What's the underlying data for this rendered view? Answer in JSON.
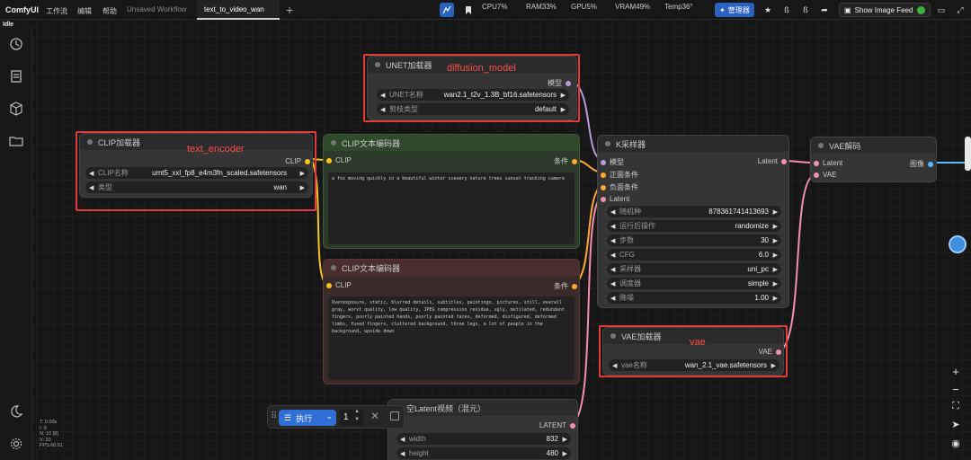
{
  "app": {
    "logo": "ComfyUI"
  },
  "menu": [
    "工作流",
    "编辑",
    "帮助"
  ],
  "tabs": [
    "Unsaved Workflow",
    "text_to_video_wan"
  ],
  "stats": {
    "cpu": "CPU7%",
    "ram": "RAM33%",
    "gpu": "GPU5%",
    "vram": "VRAM49%",
    "temp": "Temp36°"
  },
  "manager_label": "管理器",
  "feed_label": "Show Image Feed",
  "status": "Idle",
  "perf": [
    "T: 0.00s",
    "I: 0",
    "N: 10 [8]",
    "V: 20",
    "FPS:60.61"
  ],
  "nodes": {
    "unet": {
      "title": "UNET加载器",
      "out": "模型",
      "w1_label": "UNET名称",
      "w1_value": "wan2.1_t2v_1.3B_bf16.safetensors",
      "w2_label": "剪枝类型",
      "w2_value": "default"
    },
    "clip_loader": {
      "title": "CLIP加载器",
      "out": "CLIP",
      "w1_label": "CLIP名称",
      "w1_value": "umt5_xxl_fp8_e4m3fn_scaled.safetensors",
      "w2_label": "类型",
      "w2_value": "wan"
    },
    "clip_pos": {
      "title": "CLIP文本编码器",
      "in": "CLIP",
      "out": "条件",
      "text": "a fox moving quickly in a beautiful winter scenery nature trees sunset tracking camera"
    },
    "clip_neg": {
      "title": "CLIP文本编码器",
      "in": "CLIP",
      "out": "条件",
      "text": "Overexposure, static, blurred details, subtitles, paintings, pictures, still, overall gray, worst quality, low quality, JPEG compression residue, ugly, mutilated, redundant fingers, poorly painted hands, poorly painted faces, deformed, disfigured, deformed limbs, fused fingers, cluttered background, three legs, a lot of people in the background, upside down"
    },
    "ksampler": {
      "title": "K采样器",
      "in": [
        "模型",
        "正面条件",
        "负面条件",
        "Latent"
      ],
      "out": "Latent",
      "widgets": [
        {
          "label": "随机种",
          "value": "878361741413693"
        },
        {
          "label": "运行后操作",
          "value": "randomize"
        },
        {
          "label": "步数",
          "value": "30"
        },
        {
          "label": "CFG",
          "value": "6.0"
        },
        {
          "label": "采样器",
          "value": "uni_pc"
        },
        {
          "label": "调度器",
          "value": "simple"
        },
        {
          "label": "降噪",
          "value": "1.00"
        }
      ]
    },
    "vae_decode": {
      "title": "VAE解码",
      "in": [
        "Latent",
        "VAE"
      ],
      "out": "图像"
    },
    "vae_loader": {
      "title": "VAE加载器",
      "out": "VAE",
      "w1_label": "vae名称",
      "w1_value": "wan_2.1_vae.safetensors"
    },
    "latent": {
      "title": "空Latent视频（混元）",
      "out": "LATENT",
      "w1_label": "width",
      "w1_value": "832",
      "w2_label": "height",
      "w2_value": "480"
    }
  },
  "annotations": {
    "unet": "diffusion_model",
    "clip": "text_encoder",
    "vae": "vae"
  },
  "exec": {
    "label": "执行",
    "count": "1"
  },
  "colors": {
    "accent": "#2f6fd6",
    "annotation": "#e03c3c",
    "clip_wire": "#f5c518",
    "model_wire": "#b39ddb",
    "latent_wire": "#f48fb1",
    "cond_wire": "#ffa931"
  }
}
